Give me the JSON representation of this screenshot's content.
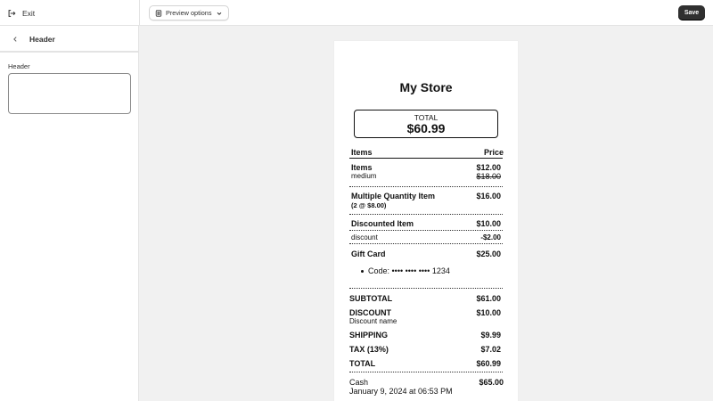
{
  "topbar": {
    "exit_label": "Exit",
    "preview_label": "Preview options",
    "save_label": "Save"
  },
  "sidebar": {
    "title": "Header",
    "field_label": "Header",
    "field_value": ""
  },
  "receipt": {
    "store_name": "My Store",
    "total_label": "TOTAL",
    "total_value": "$60.99",
    "columns": {
      "items": "Items",
      "price": "Price"
    },
    "items": [
      {
        "name": "Items",
        "price": "$12.00",
        "variant": "medium",
        "original_price": "$18.00"
      },
      {
        "name": "Multiple Quantity Item",
        "price": "$16.00",
        "qty": "(2 @ $8.00)"
      },
      {
        "name": "Discounted Item",
        "price": "$10.00",
        "discount_label": "discount",
        "discount_value": "-$2.00"
      },
      {
        "name": "Gift Card",
        "price": "$25.00",
        "code": "Code: •••• •••• •••• 1234"
      }
    ],
    "summary": {
      "subtotal_label": "SUBTOTAL",
      "subtotal_value": "$61.00",
      "discount_label": "DISCOUNT",
      "discount_value": "$10.00",
      "discount_name": "Discount name",
      "shipping_label": "SHIPPING",
      "shipping_value": "$9.99",
      "tax_label": "TAX (13%)",
      "tax_value": "$7.02",
      "total_label": "TOTAL",
      "total_value": "$60.99"
    },
    "payment": {
      "method": "Cash",
      "amount": "$65.00",
      "date": "January 9, 2024 at 06:53 PM"
    }
  }
}
